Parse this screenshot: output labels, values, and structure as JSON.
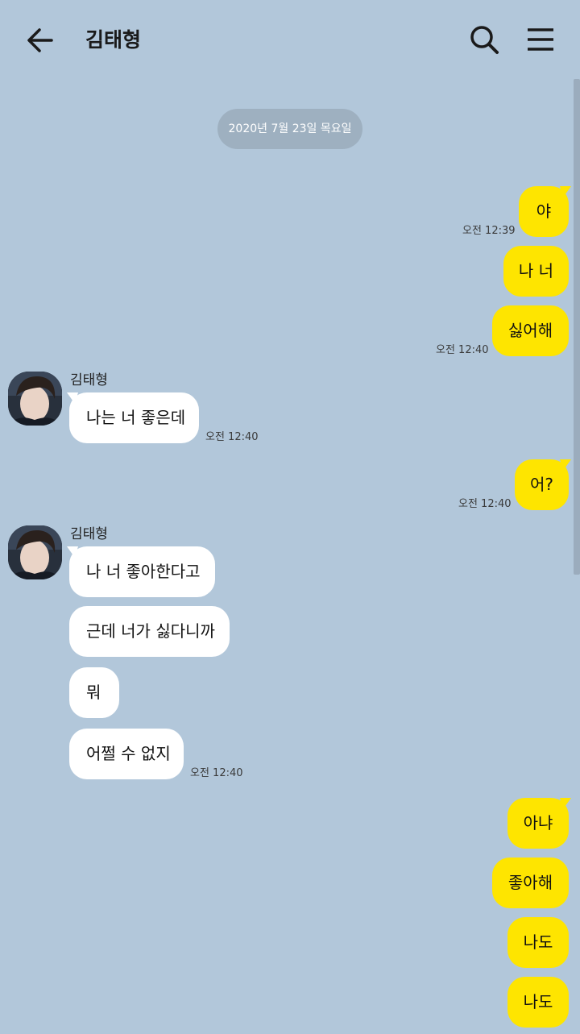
{
  "header": {
    "title": "김태형",
    "back_icon": "arrow-left-icon",
    "search_icon": "search-icon",
    "menu_icon": "hamburger-menu-icon"
  },
  "date_divider": "2020년 7월 23일 목요일",
  "colors": {
    "background": "#b2c7da",
    "my_bubble": "#fee500",
    "other_bubble": "#ffffff",
    "date_pill": "#9eb0c0"
  },
  "messages": {
    "m1": "야",
    "m2": "나 너",
    "m3": "싫어해",
    "m4": "나는 너 좋은데",
    "m5": "어?",
    "m6": "나 너 좋아한다고",
    "m7": "근데 너가 싫다니까",
    "m8": "뭐",
    "m9": "어쩔 수 없지",
    "m10": "아냐",
    "m11": "좋아해",
    "m12": "나도",
    "m13": "나도"
  },
  "times": {
    "t1": "오전 12:39",
    "t2": "오전 12:40",
    "t3": "오전 12:40",
    "t4": "오전 12:40",
    "t5": "오전 12:40"
  },
  "senders": {
    "s1": "김태형",
    "s2": "김태형"
  }
}
